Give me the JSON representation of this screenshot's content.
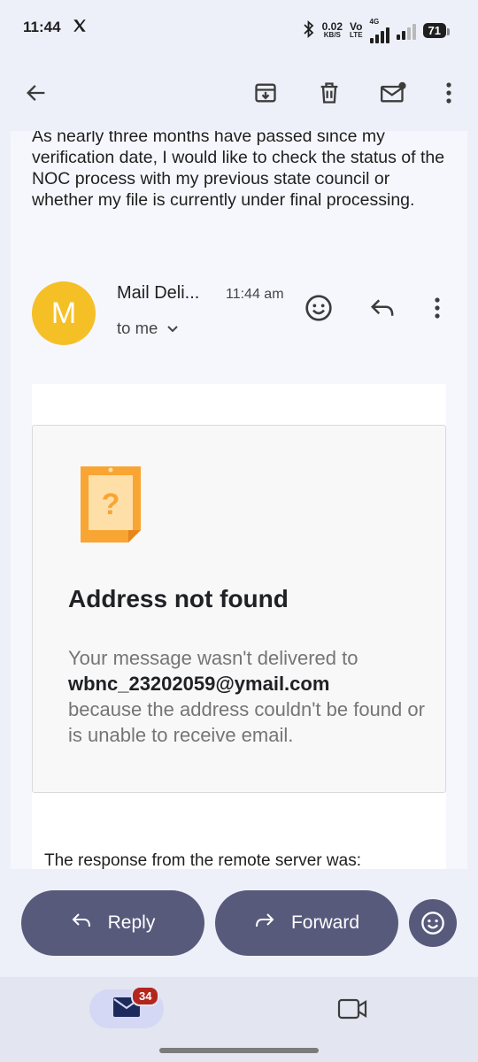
{
  "status_bar": {
    "time": "11:44",
    "x_app_icon": "x-logo-icon",
    "bluetooth_icon": "bluetooth-icon",
    "speed_value": "0.02",
    "speed_unit": "KB/S",
    "volte_top": "Vo",
    "volte_bottom": "LTE",
    "network": "4G",
    "battery": "71"
  },
  "toolbar": {
    "back_icon": "arrow-back-icon",
    "archive_icon": "archive-icon",
    "delete_icon": "trash-icon",
    "mark_unread_icon": "mail-unread-icon",
    "more_icon": "more-vert-icon"
  },
  "previous_message": {
    "text": "As nearly three months have passed since my verification date, I would like to check the status of the NOC process with my previous state council or whether my file is currently under final processing."
  },
  "message": {
    "avatar_letter": "M",
    "avatar_color": "#f5bf26",
    "sender": "Mail Deli...",
    "time": "11:44 am",
    "recipient": "to me",
    "notice_title": "Address not found",
    "notice_line1": "Your message wasn't delivered to",
    "notice_address": "wbnc_23202059@ymail.com",
    "notice_line2": "because the address couldn't be found or is unable to receive email.",
    "remote_text": "The response from the remote server was:"
  },
  "actions": {
    "reply_label": "Reply",
    "forward_label": "Forward",
    "reply_icon": "reply-icon",
    "forward_icon": "forward-icon",
    "emoji_icon": "emoji-icon"
  },
  "bottom_nav": {
    "mail_icon": "mail-icon",
    "mail_badge": "34",
    "video_icon": "video-icon"
  },
  "colors": {
    "accent": "#585a7c",
    "notice_icon": "#f9a533",
    "badge": "#b3261e"
  }
}
